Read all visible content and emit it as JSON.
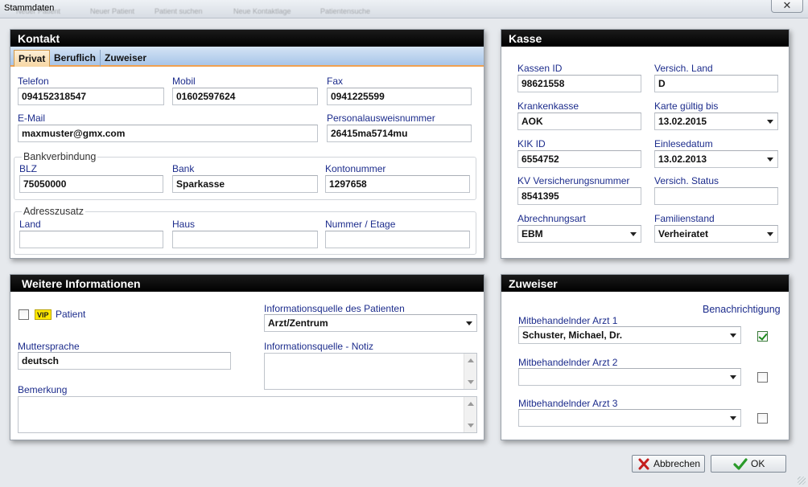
{
  "window": {
    "title": "Stammdaten",
    "close_glyph": "✕",
    "ghost_toolbar": [
      "Neuer Patient",
      "Patient suchen",
      "Neue Kontaktlage",
      "Patientensuche"
    ]
  },
  "kontakt": {
    "title": "Kontakt",
    "tabs": [
      "Privat",
      "Beruflich",
      "Zuweiser"
    ],
    "telefon": {
      "label": "Telefon",
      "value": "094152318547"
    },
    "mobil": {
      "label": "Mobil",
      "value": "01602597624"
    },
    "fax": {
      "label": "Fax",
      "value": "0941225599"
    },
    "email": {
      "label": "E-Mail",
      "value": "maxmuster@gmx.com"
    },
    "personalausweis": {
      "label": "Personalausweisnummer",
      "value": "26415ma5714mu"
    },
    "bank_group": "Bankverbindung",
    "blz": {
      "label": "BLZ",
      "value": "75050000"
    },
    "bank": {
      "label": "Bank",
      "value": "Sparkasse"
    },
    "kontonummer": {
      "label": "Kontonummer",
      "value": "1297658"
    },
    "adress_group": "Adresszusatz",
    "land": {
      "label": "Land",
      "value": ""
    },
    "haus": {
      "label": "Haus",
      "value": ""
    },
    "nummer_etage": {
      "label": "Nummer / Etage",
      "value": ""
    }
  },
  "kasse": {
    "title": "Kasse",
    "kassen_id": {
      "label": "Kassen ID",
      "value": "98621558"
    },
    "versich_land": {
      "label": "Versich. Land",
      "value": "D"
    },
    "krankenkasse": {
      "label": "Krankenkasse",
      "value": "AOK"
    },
    "karte_gueltig": {
      "label": "Karte gültig bis",
      "value": "13.02.2015"
    },
    "kik_id": {
      "label": "KIK ID",
      "value": "6554752"
    },
    "einlesedatum": {
      "label": "Einlesedatum",
      "value": "13.02.2013"
    },
    "kv_nummer": {
      "label": "KV Versicherungsnummer",
      "value": "8541395"
    },
    "versich_status": {
      "label": "Versich. Status",
      "value": ""
    },
    "abrechnungsart": {
      "label": "Abrechnungsart",
      "value": "EBM"
    },
    "familienstand": {
      "label": "Familienstand",
      "value": "Verheiratet"
    }
  },
  "weitere": {
    "title": "Weitere Informationen",
    "vip_badge": "VIP",
    "vip_label": "Patient",
    "vip_checked": false,
    "infoquelle": {
      "label": "Informationsquelle des Patienten",
      "value": "Arzt/Zentrum"
    },
    "muttersprache": {
      "label": "Muttersprache",
      "value": "deutsch"
    },
    "infoquelle_notiz": {
      "label": "Informationsquelle - Notiz",
      "value": ""
    },
    "bemerkung": {
      "label": "Bemerkung",
      "value": ""
    }
  },
  "zuweiser": {
    "title": "Zuweiser",
    "benachrichtigung": "Benachrichtigung",
    "aerzte": [
      {
        "label": "Mitbehandelnder Arzt 1",
        "value": "Schuster, Michael, Dr.",
        "notify": true
      },
      {
        "label": "Mitbehandelnder Arzt 2",
        "value": "",
        "notify": false
      },
      {
        "label": "Mitbehandelnder Arzt 3",
        "value": "",
        "notify": false
      }
    ]
  },
  "buttons": {
    "cancel": "Abbrechen",
    "ok": "OK"
  },
  "colors": {
    "label_blue": "#1c2c8c",
    "header_black": "#000000",
    "tab_active": "#f7d7a4",
    "ok_green": "#2a9a2a",
    "cancel_red": "#c41e1e"
  }
}
